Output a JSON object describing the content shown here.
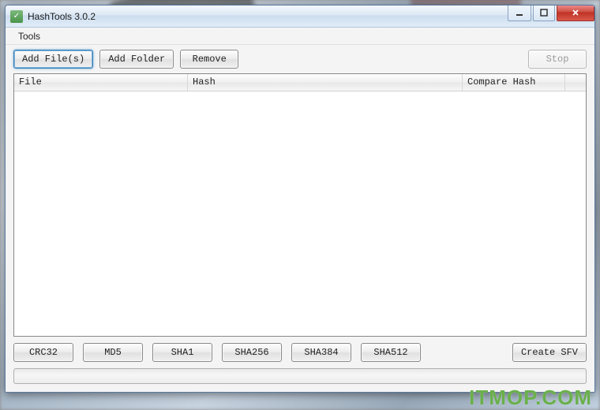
{
  "window": {
    "title": "HashTools 3.0.2"
  },
  "menu": {
    "tools": "Tools"
  },
  "toolbar": {
    "add_files": "Add File(s)",
    "add_folder": "Add Folder",
    "remove": "Remove",
    "stop": "Stop"
  },
  "columns": {
    "file": "File",
    "hash": "Hash",
    "compare": "Compare Hash"
  },
  "hash_buttons": {
    "crc32": "CRC32",
    "md5": "MD5",
    "sha1": "SHA1",
    "sha256": "SHA256",
    "sha384": "SHA384",
    "sha512": "SHA512",
    "create_sfv": "Create SFV"
  },
  "watermark": "ITMOP.COM"
}
